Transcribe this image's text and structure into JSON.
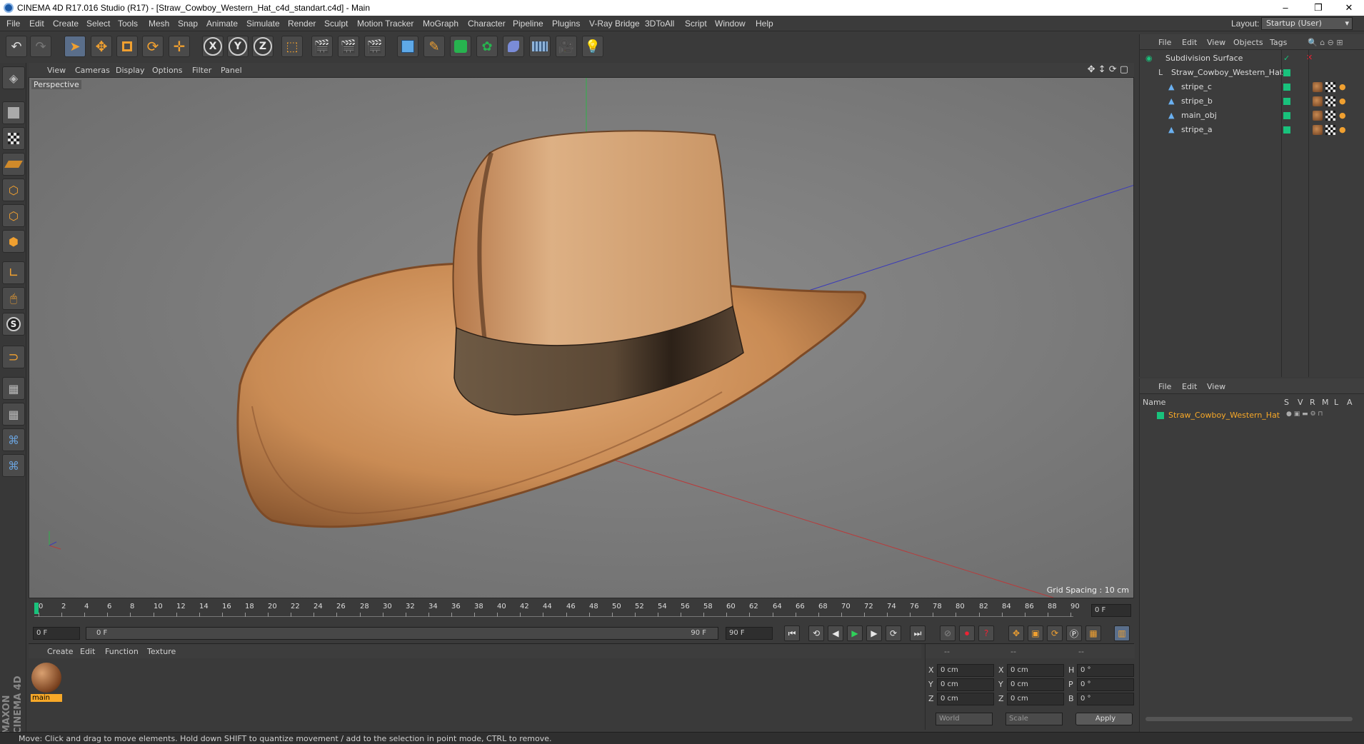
{
  "window": {
    "title": "CINEMA 4D R17.016 Studio (R17) - [Straw_Cowboy_Western_Hat_c4d_standart.c4d] - Main",
    "controls": [
      "–",
      "❐",
      "✕"
    ]
  },
  "menubar": {
    "items": [
      "File",
      "Edit",
      "Create",
      "Select",
      "Tools",
      "Mesh",
      "Snap",
      "Animate",
      "Simulate",
      "Render",
      "Sculpt",
      "Motion Tracker",
      "MoGraph",
      "Character",
      "Pipeline",
      "Plugins",
      "V-Ray Bridge",
      "3DToAll",
      "Script",
      "Window",
      "Help"
    ],
    "layout_label": "Layout:",
    "layout_value": "Startup (User)"
  },
  "toolbar": {
    "axis_x": "X",
    "axis_y": "Y",
    "axis_z": "Z"
  },
  "viewport": {
    "menu": [
      "View",
      "Cameras",
      "Display",
      "Options",
      "Filter",
      "Panel"
    ],
    "label": "Perspective",
    "grid_spacing": "Grid Spacing : 10 cm"
  },
  "timeline": {
    "ticks": [
      "0",
      "2",
      "4",
      "6",
      "8",
      "10",
      "12",
      "14",
      "16",
      "18",
      "20",
      "22",
      "24",
      "26",
      "28",
      "30",
      "32",
      "34",
      "36",
      "38",
      "40",
      "42",
      "44",
      "46",
      "48",
      "50",
      "52",
      "54",
      "56",
      "58",
      "60",
      "62",
      "64",
      "66",
      "68",
      "70",
      "72",
      "74",
      "76",
      "78",
      "80",
      "82",
      "84",
      "86",
      "88",
      "90"
    ],
    "current_frame": "0 F",
    "start": "0 F",
    "range_start": "0 F",
    "range_end": "90 F",
    "end": "90 F"
  },
  "material_manager": {
    "menu": [
      "Create",
      "Edit",
      "Function",
      "Texture"
    ],
    "material_name": "main"
  },
  "coordinates": {
    "header": [
      "--",
      "--",
      "--"
    ],
    "rows": [
      {
        "a": "X",
        "av": "0 cm",
        "b": "X",
        "bv": "0 cm",
        "c": "H",
        "cv": "0 °"
      },
      {
        "a": "Y",
        "av": "0 cm",
        "b": "Y",
        "bv": "0 cm",
        "c": "P",
        "cv": "0 °"
      },
      {
        "a": "Z",
        "av": "0 cm",
        "b": "Z",
        "bv": "0 cm",
        "c": "B",
        "cv": "0 °"
      }
    ],
    "mode1": "World",
    "mode2": "Scale",
    "apply": "Apply"
  },
  "object_manager": {
    "menu": [
      "File",
      "Edit",
      "View",
      "Objects",
      "Tags"
    ],
    "objects": [
      {
        "name": "Subdivision Surface",
        "indent": 0
      },
      {
        "name": "Straw_Cowboy_Western_Hat",
        "indent": 1
      },
      {
        "name": "stripe_c",
        "indent": 2
      },
      {
        "name": "stripe_b",
        "indent": 2
      },
      {
        "name": "main_obj",
        "indent": 2
      },
      {
        "name": "stripe_a",
        "indent": 2
      }
    ]
  },
  "attribute_manager": {
    "menu": [
      "File",
      "Edit",
      "View"
    ],
    "columns": {
      "name": "Name",
      "s": "S",
      "v": "V",
      "r": "R",
      "m": "M",
      "l": "L",
      "a": "A"
    },
    "layer_name": "Straw_Cowboy_Western_Hat"
  },
  "status": "Move: Click and drag to move elements. Hold down SHIFT to quantize movement / add to the selection in point mode, CTRL to remove.",
  "brand": "MAXON CINEMA 4D",
  "colors": {
    "accent": "#19c27c",
    "selected_text": "#f7a828",
    "background": "#3a3a3a"
  }
}
